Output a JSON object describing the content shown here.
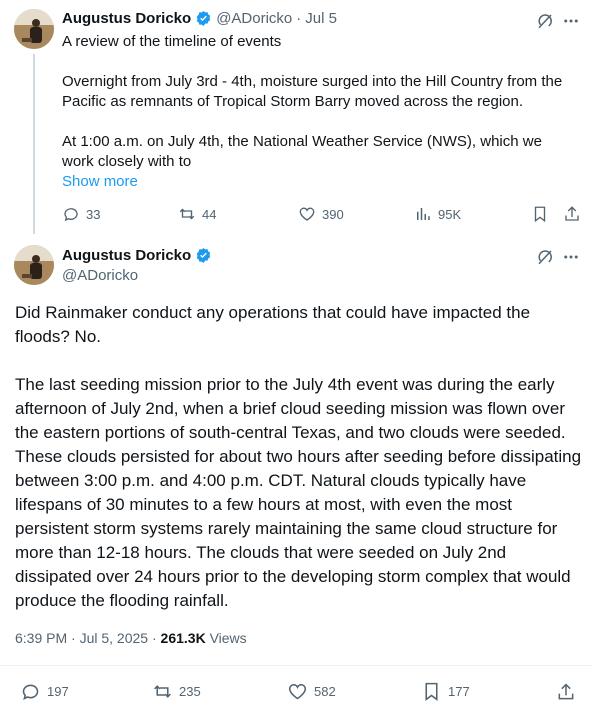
{
  "colors": {
    "accent": "#1d9bf0",
    "muted": "#536471",
    "text": "#0f1419",
    "verified": "#1d9bf0"
  },
  "tweet1": {
    "name": "Augustus Doricko",
    "handle": "@ADoricko",
    "sep": "·",
    "date": "Jul 5",
    "text": "A review of the timeline of events\n\nOvernight from July 3rd - 4th, moisture surged into the Hill Country from the Pacific as remnants of Tropical Storm Barry moved across the region.\n\nAt 1:00 a.m. on July 4th, the National Weather Service (NWS), which we work closely with to",
    "show_more": "Show more",
    "replies": "33",
    "reposts": "44",
    "likes": "390",
    "views": "95K"
  },
  "tweet2": {
    "name": "Augustus Doricko",
    "handle": "@ADoricko",
    "text": "Did Rainmaker conduct any operations that could have impacted the floods? No.\n\nThe last seeding mission prior to the July 4th event was during the early afternoon of July 2nd, when a brief cloud seeding mission was flown over the eastern portions of south-central Texas, and two clouds were seeded. These clouds persisted for about two hours after seeding before dissipating between 3:00 p.m. and 4:00 p.m. CDT. Natural clouds typically have lifespans of 30 minutes to a few hours at most, with even the most persistent storm systems rarely maintaining the same cloud structure for more than 12-18 hours. The clouds that were seeded on July 2nd dissipated over 24 hours prior to the developing storm complex that would produce the flooding rainfall.",
    "timestamp": "6:39 PM · Jul 5, 2025 · ",
    "views_count": "261.3K",
    "views_label": " Views",
    "replies": "197",
    "reposts": "235",
    "likes": "582",
    "bookmarks": "177"
  }
}
